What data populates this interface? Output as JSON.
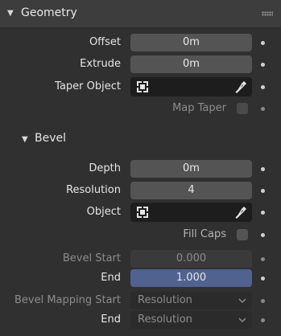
{
  "geometry": {
    "title": "Geometry",
    "offset": {
      "label": "Offset",
      "value": "0m"
    },
    "extrude": {
      "label": "Extrude",
      "value": "0m"
    },
    "taper_object": {
      "label": "Taper Object"
    },
    "map_taper": {
      "label": "Map Taper",
      "checked": false
    }
  },
  "bevel": {
    "title": "Bevel",
    "depth": {
      "label": "Depth",
      "value": "0m"
    },
    "resolution": {
      "label": "Resolution",
      "value": "4"
    },
    "object": {
      "label": "Object"
    },
    "fill_caps": {
      "label": "Fill Caps",
      "checked": false
    },
    "bevel_start": {
      "label": "Bevel Start",
      "value": "0.000"
    },
    "end": {
      "label": "End",
      "value": "1.000"
    },
    "mapping_start": {
      "label": "Bevel Mapping Start",
      "value": "Resolution"
    },
    "mapping_end": {
      "label": "End",
      "value": "Resolution"
    }
  },
  "colors": {
    "background": "#303030",
    "header": "#3d3d3d",
    "field": "#545454",
    "active_field": "#4f6290"
  },
  "icons": [
    "disclosure-triangle-icon",
    "drag-grip-icon",
    "object-icon",
    "eyedropper-icon",
    "dropdown-chevron-icon",
    "animate-property-dot-icon"
  ]
}
